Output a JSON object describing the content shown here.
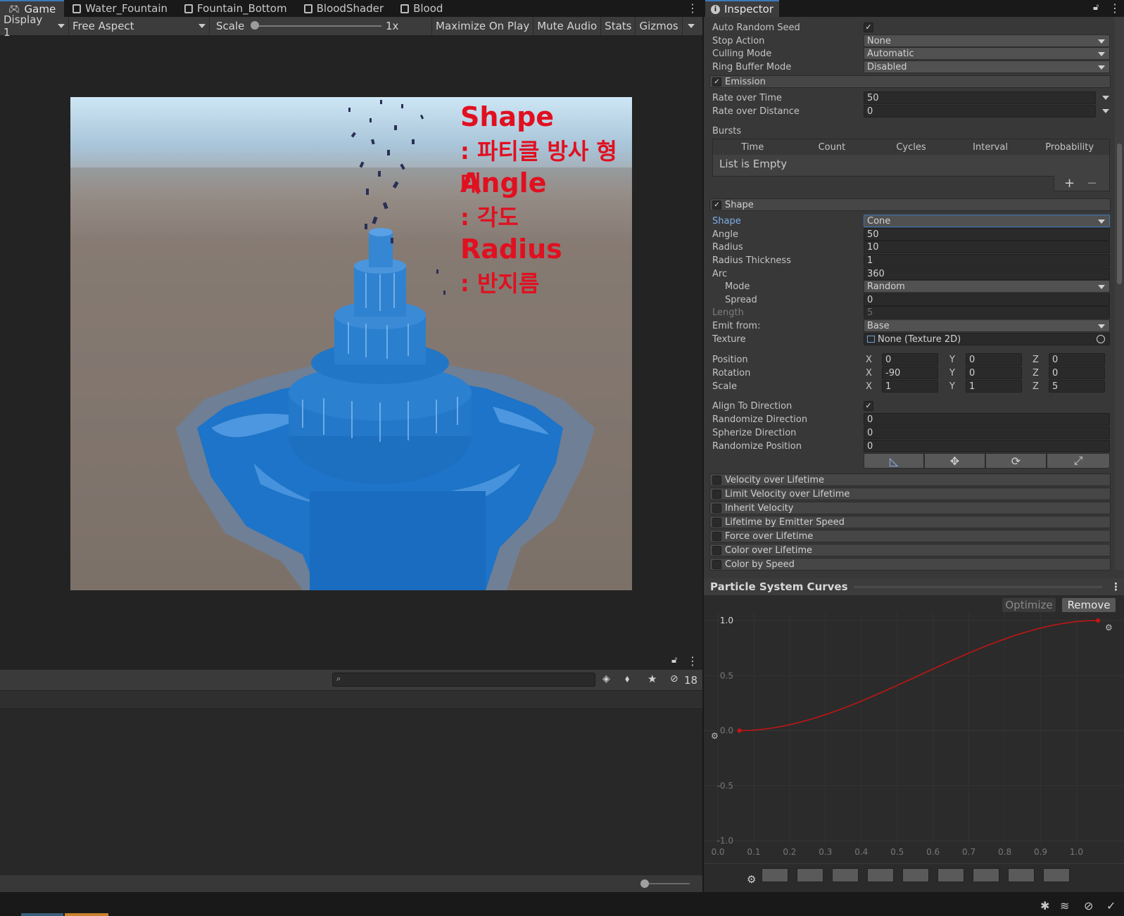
{
  "tabs": [
    {
      "label": "Game",
      "icon": "gamepad-icon",
      "active": true
    },
    {
      "label": "Water_Fountain",
      "icon": "prefab-icon"
    },
    {
      "label": "Fountain_Bottom",
      "icon": "prefab-icon"
    },
    {
      "label": "BloodShader",
      "icon": "prefab-icon"
    },
    {
      "label": "Blood",
      "icon": "prefab-icon"
    }
  ],
  "game_toolbar": {
    "display": "Display 1",
    "aspect": "Free Aspect",
    "scale_label": "Scale",
    "scale_value": "1x",
    "maximize": "Maximize On Play",
    "mute": "Mute Audio",
    "stats": "Stats",
    "gizmos": "Gizmos"
  },
  "annotations": {
    "shape_title": "Shape",
    "shape_desc": ": 파티클 방사 형태",
    "angle_title": "Angle",
    "angle_desc": ": 각도",
    "radius_title": "Radius",
    "radius_desc": ": 반지름"
  },
  "console": {
    "hidden_count": "18"
  },
  "inspector": {
    "title": "Inspector",
    "auto_random_seed": "Auto Random Seed",
    "stop_action": {
      "label": "Stop Action",
      "value": "None"
    },
    "culling_mode": {
      "label": "Culling Mode",
      "value": "Automatic"
    },
    "ring_buffer_mode": {
      "label": "Ring Buffer Mode",
      "value": "Disabled"
    },
    "emission": {
      "title": "Emission",
      "rate_over_time": {
        "label": "Rate over Time",
        "value": "50"
      },
      "rate_over_distance": {
        "label": "Rate over Distance",
        "value": "0"
      },
      "bursts_label": "Bursts",
      "bursts_columns": [
        "Time",
        "Count",
        "Cycles",
        "Interval",
        "Probability"
      ],
      "bursts_empty": "List is Empty"
    },
    "shape": {
      "title": "Shape",
      "shape": {
        "label": "Shape",
        "value": "Cone"
      },
      "angle": {
        "label": "Angle",
        "value": "50"
      },
      "radius": {
        "label": "Radius",
        "value": "10"
      },
      "radius_thickness": {
        "label": "Radius Thickness",
        "value": "1"
      },
      "arc": {
        "label": "Arc",
        "value": "360"
      },
      "mode": {
        "label": "Mode",
        "value": "Random"
      },
      "spread": {
        "label": "Spread",
        "value": "0"
      },
      "length": {
        "label": "Length",
        "value": "5"
      },
      "emit_from": {
        "label": "Emit from:",
        "value": "Base"
      },
      "texture": {
        "label": "Texture",
        "value": "None (Texture 2D)"
      },
      "position": {
        "label": "Position",
        "x": "0",
        "y": "0",
        "z": "0"
      },
      "rotation": {
        "label": "Rotation",
        "x": "-90",
        "y": "0",
        "z": "0"
      },
      "scale": {
        "label": "Scale",
        "x": "1",
        "y": "1",
        "z": "5"
      },
      "align_to_direction": "Align To Direction",
      "randomize_direction": {
        "label": "Randomize Direction",
        "value": "0"
      },
      "spherize_direction": {
        "label": "Spherize Direction",
        "value": "0"
      },
      "randomize_position": {
        "label": "Randomize Position",
        "value": "0"
      }
    },
    "modules": [
      "Velocity over Lifetime",
      "Limit Velocity over Lifetime",
      "Inherit Velocity",
      "Lifetime by Emitter Speed",
      "Force over Lifetime",
      "Color over Lifetime",
      "Color by Speed"
    ]
  },
  "curves": {
    "title": "Particle System Curves",
    "optimize": "Optimize",
    "remove": "Remove",
    "y_ticks": [
      "1.0",
      "0.5",
      "0.0",
      "-0.5",
      "-1.0"
    ],
    "x_ticks": [
      "0.0",
      "0.1",
      "0.2",
      "0.3",
      "0.4",
      "0.5",
      "0.6",
      "0.7",
      "0.8",
      "0.9",
      "1.0"
    ],
    "curve_color": "#c81414"
  },
  "colors": {
    "accent": "#3a79bb",
    "annotation": "#e01020",
    "water": "#1d74c8"
  }
}
